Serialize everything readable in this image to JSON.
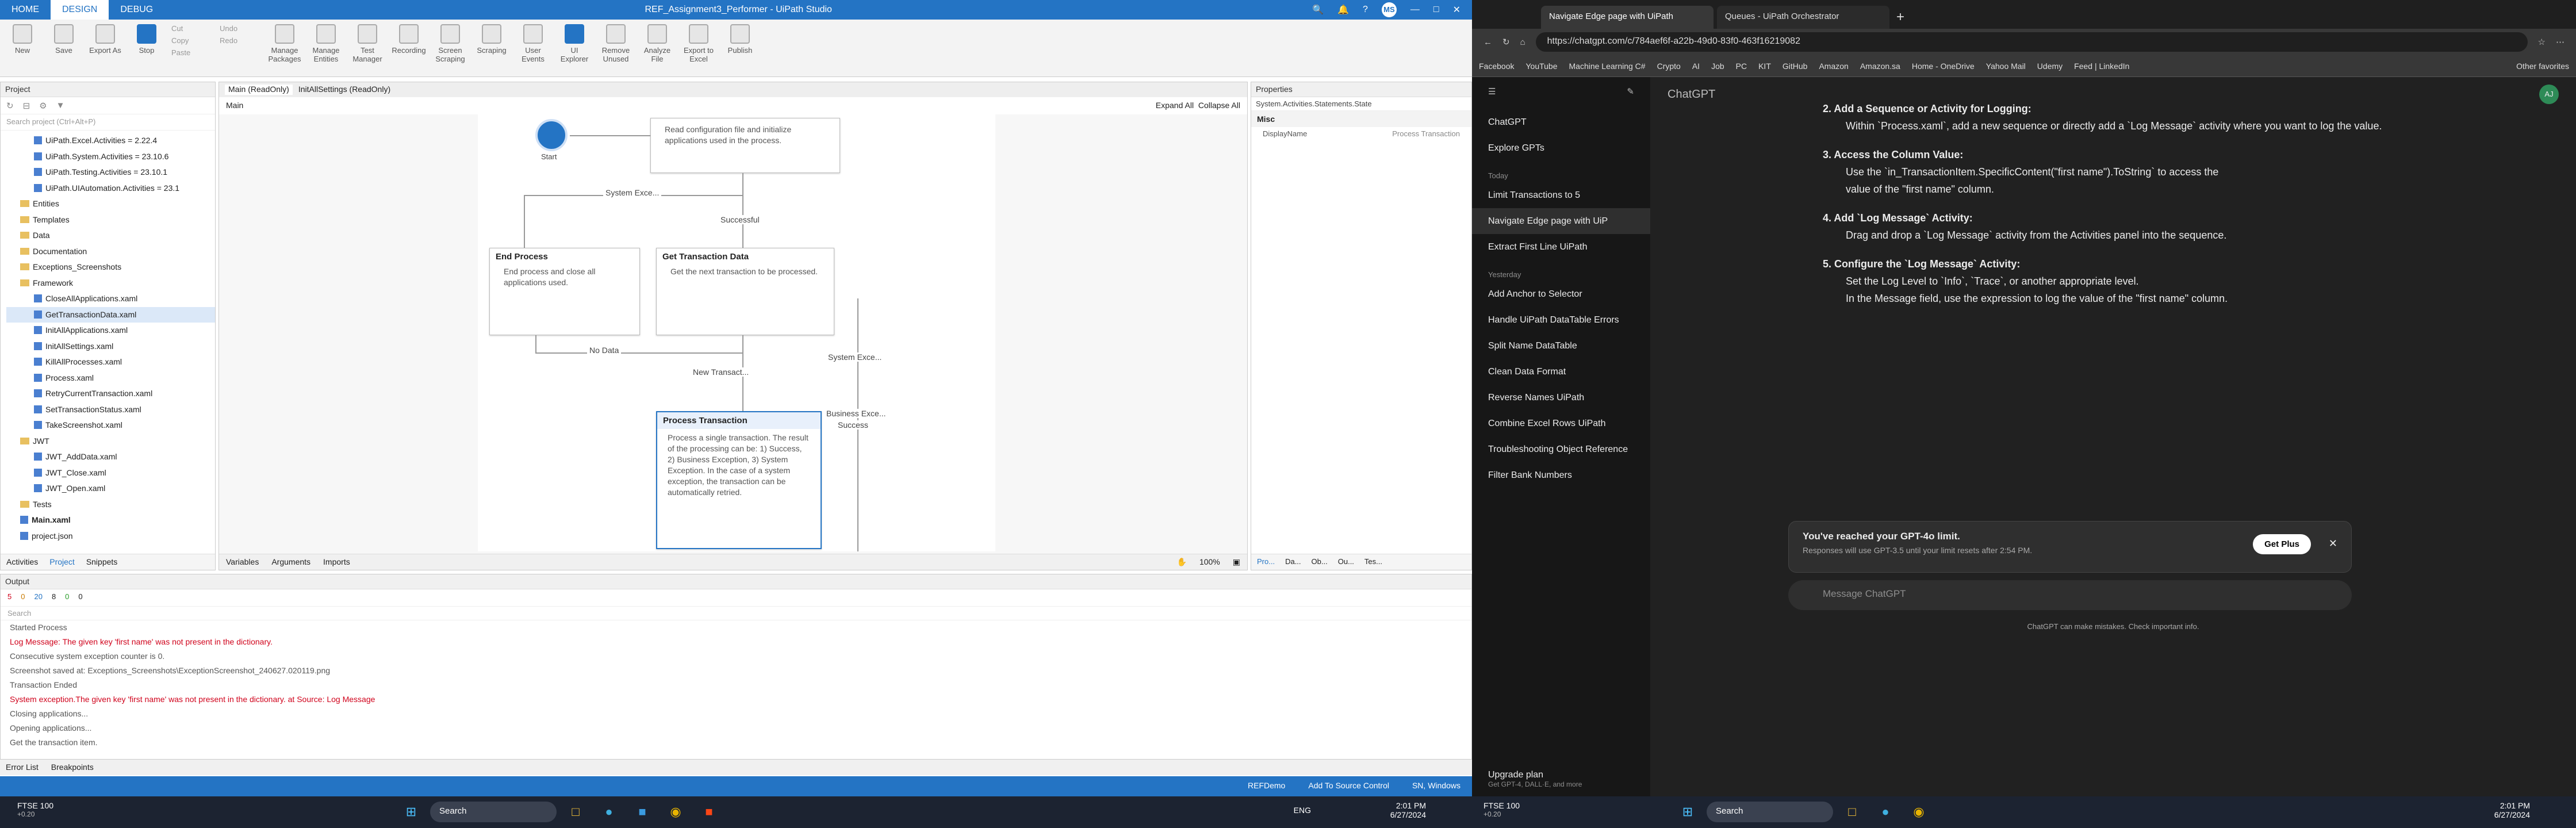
{
  "uipath": {
    "tabs": [
      "HOME",
      "DESIGN",
      "DEBUG"
    ],
    "title": "REF_Assignment3_Performer - UiPath Studio",
    "user": "MS",
    "ribbon": [
      {
        "label": "New",
        "blue": false
      },
      {
        "label": "Save",
        "blue": false
      },
      {
        "label": "Export As",
        "blue": false
      },
      {
        "label": "Stop",
        "blue": true
      },
      {
        "label": "Manage Packages",
        "blue": false
      },
      {
        "label": "Manage Entities",
        "blue": false
      },
      {
        "label": "Test Manager",
        "blue": false
      },
      {
        "label": "Recording",
        "blue": false
      },
      {
        "label": "Screen Scraping",
        "blue": false
      },
      {
        "label": "Scraping",
        "blue": false
      },
      {
        "label": "User Events",
        "blue": false
      },
      {
        "label": "UI Explorer",
        "blue": true
      },
      {
        "label": "Remove Unused",
        "blue": false
      },
      {
        "label": "Analyze File",
        "blue": false
      },
      {
        "label": "Export to Excel",
        "blue": false
      },
      {
        "label": "Publish",
        "blue": false
      }
    ],
    "clipboard": [
      "Cut",
      "Copy",
      "Paste"
    ],
    "undo": [
      "Undo",
      "Redo"
    ],
    "project": {
      "title": "Project",
      "search_placeholder": "Search project (Ctrl+Alt+P)",
      "items": [
        {
          "label": "UiPath.Excel.Activities = 2.22.4",
          "kind": "x",
          "ind": 2
        },
        {
          "label": "UiPath.System.Activities = 23.10.6",
          "kind": "x",
          "ind": 2
        },
        {
          "label": "UiPath.Testing.Activities = 23.10.1",
          "kind": "x",
          "ind": 2
        },
        {
          "label": "UiPath.UIAutomation.Activities = 23.1",
          "kind": "x",
          "ind": 2
        },
        {
          "label": "Entities",
          "kind": "f",
          "ind": 1
        },
        {
          "label": "Templates",
          "kind": "f",
          "ind": 1
        },
        {
          "label": "Data",
          "kind": "f",
          "ind": 1
        },
        {
          "label": "Documentation",
          "kind": "f",
          "ind": 1
        },
        {
          "label": "Exceptions_Screenshots",
          "kind": "f",
          "ind": 1
        },
        {
          "label": "Framework",
          "kind": "f",
          "ind": 1
        },
        {
          "label": "CloseAllApplications.xaml",
          "kind": "x",
          "ind": 2
        },
        {
          "label": "GetTransactionData.xaml",
          "kind": "x",
          "ind": 2,
          "sel": true
        },
        {
          "label": "InitAllApplications.xaml",
          "kind": "x",
          "ind": 2
        },
        {
          "label": "InitAllSettings.xaml",
          "kind": "x",
          "ind": 2
        },
        {
          "label": "KillAllProcesses.xaml",
          "kind": "x",
          "ind": 2
        },
        {
          "label": "Process.xaml",
          "kind": "x",
          "ind": 2
        },
        {
          "label": "RetryCurrentTransaction.xaml",
          "kind": "x",
          "ind": 2
        },
        {
          "label": "SetTransactionStatus.xaml",
          "kind": "x",
          "ind": 2
        },
        {
          "label": "TakeScreenshot.xaml",
          "kind": "x",
          "ind": 2
        },
        {
          "label": "JWT",
          "kind": "f",
          "ind": 1
        },
        {
          "label": "JWT_AddData.xaml",
          "kind": "x",
          "ind": 2
        },
        {
          "label": "JWT_Close.xaml",
          "kind": "x",
          "ind": 2
        },
        {
          "label": "JWT_Open.xaml",
          "kind": "x",
          "ind": 2
        },
        {
          "label": "Tests",
          "kind": "f",
          "ind": 1
        },
        {
          "label": "Main.xaml",
          "kind": "x",
          "ind": 1,
          "bold": true
        },
        {
          "label": "project.json",
          "kind": "x",
          "ind": 1
        }
      ],
      "bottom_tabs": [
        "Activities",
        "Project",
        "Snippets"
      ]
    },
    "doc_tabs": [
      "Main (ReadOnly)",
      "InitAllSettings (ReadOnly)"
    ],
    "breadcrumb": "Main",
    "expand_all": "Expand All",
    "collapse_all": "Collapse All",
    "designer_tabs": [
      "Variables",
      "Arguments",
      "Imports"
    ],
    "zoom": "100%",
    "flow": {
      "start": "Start",
      "init_text": "Read configuration file and initialize applications used in the process.",
      "end_title": "End Process",
      "end_text": "End process and close all applications used.",
      "get_title": "Get Transaction Data",
      "get_text": "Get the next transaction to be processed.",
      "proc_title": "Process Transaction",
      "proc_text": "Process a single transaction. The result of the processing can be: 1) Success, 2) Business Exception, 3) System Exception. In the case of a system exception, the transaction can be automatically retried.",
      "labels": {
        "sys_exc_1": "System Exce...",
        "successful": "Successful",
        "no_data": "No Data",
        "new_transaction": "New Transact...",
        "sys_exc_2": "System Exce...",
        "bus_exc": "Business Exce...",
        "success": "Success"
      }
    },
    "properties": {
      "title": "Properties",
      "path": "System.Activities.Statements.State",
      "section": "Misc",
      "key": "DisplayName",
      "value": "Process Transaction"
    },
    "right_tabs": [
      "Pro...",
      "Da...",
      "Ob...",
      "Ou...",
      "Tes..."
    ],
    "output": {
      "title": "Output",
      "counters": [
        "5",
        "0",
        "20",
        "8",
        "0",
        "0"
      ],
      "search": "Search",
      "lines": [
        {
          "t": "Started Process",
          "c": "inf"
        },
        {
          "t": "Log Message: The given key 'first name' was not present in the dictionary.",
          "c": "err"
        },
        {
          "t": "Consecutive system exception counter is 0.",
          "c": "inf"
        },
        {
          "t": "Screenshot saved at: Exceptions_Screenshots\\ExceptionScreenshot_240627.020119.png",
          "c": "inf"
        },
        {
          "t": "Transaction Ended",
          "c": "inf"
        },
        {
          "t": "System exception.The given key 'first name' was not present in the dictionary. at Source: Log Message",
          "c": "err"
        },
        {
          "t": "Closing applications...",
          "c": "inf"
        },
        {
          "t": "Opening applications...",
          "c": "inf"
        },
        {
          "t": "Get the transaction item.",
          "c": "inf"
        }
      ],
      "bottom_tabs": [
        "Error List",
        "Breakpoints"
      ]
    },
    "status": {
      "profile": "REFDemo",
      "source": "Add To Source Control",
      "sn": "SN, Windows"
    }
  },
  "edge": {
    "tabs": [
      {
        "label": "Navigate Edge page with UiPath",
        "on": true
      },
      {
        "label": "Queues - UiPath Orchestrator",
        "on": false
      }
    ],
    "url": "https://chatgpt.com/c/784aef6f-a22b-49d0-83f0-463f16219082",
    "favorites": [
      "Facebook",
      "YouTube",
      "Machine Learning C#",
      "Crypto",
      "AI",
      "Job",
      "PC",
      "KIT",
      "GitHub",
      "Amazon",
      "Amazon.sa",
      "Home - OneDrive",
      "Yahoo Mail",
      "Udemy",
      "Feed | LinkedIn"
    ],
    "other_fav": "Other favorites",
    "side": {
      "top": [
        "ChatGPT",
        "Explore GPTs"
      ],
      "today_h": "Today",
      "today": [
        "Limit Transactions to 5",
        "Navigate Edge page with UiP",
        "Extract First Line UiPath"
      ],
      "yest_h": "Yesterday",
      "yest": [
        "Add Anchor to Selector",
        "Handle UiPath DataTable Errors",
        "Split Name DataTable",
        "Clean Data Format",
        "Reverse Names UiPath",
        "Combine Excel Rows UiPath",
        "Troubleshooting Object Reference",
        "Filter Bank Numbers"
      ],
      "upgrade": "Upgrade plan",
      "upgrade_sub": "Get GPT-4, DALL·E, and more"
    },
    "main": {
      "model": "ChatGPT",
      "user": "AJ",
      "s2": "2. Add a Sequence or Activity for Logging:",
      "s2b": "Within `Process.xaml`, add a new sequence or directly add a `Log Message` activity where you want to log the value.",
      "s3": "3. Access the Column Value:",
      "s3b1": "Use the `in_TransactionItem.SpecificContent(\"first name\").ToString` to access the",
      "s3b2": "value of the \"first name\" column.",
      "s4": "4. Add `Log Message` Activity:",
      "s4b": "Drag and drop a `Log Message` activity from the Activities panel into the sequence.",
      "s5": "5. Configure the `Log Message` Activity:",
      "s5b1": "Set the Log Level to `Info`, `Trace`, or another appropriate level.",
      "s5b2": "In the Message field, use the expression to log the value of the \"first name\" column.",
      "limit_title": "You've reached your GPT-4o limit.",
      "limit_sub": "Responses will use GPT-3.5 until your limit resets after 2:54 PM.",
      "get_plus": "Get Plus",
      "input_placeholder": "Message ChatGPT",
      "disclaimer": "ChatGPT can make mistakes. Check important info."
    }
  },
  "taskbar_left": {
    "stock": "FTSE 100",
    "stock_v": "+0.20",
    "search": "Search",
    "profile": "REFDemo",
    "time": "2:01 PM",
    "date": "6/27/2024",
    "lang": "ENG"
  },
  "taskbar_right": {
    "stock": "FTSE 100",
    "stock_v": "+0.20",
    "search": "Search",
    "time": "2:01 PM",
    "date": "6/27/2024"
  }
}
